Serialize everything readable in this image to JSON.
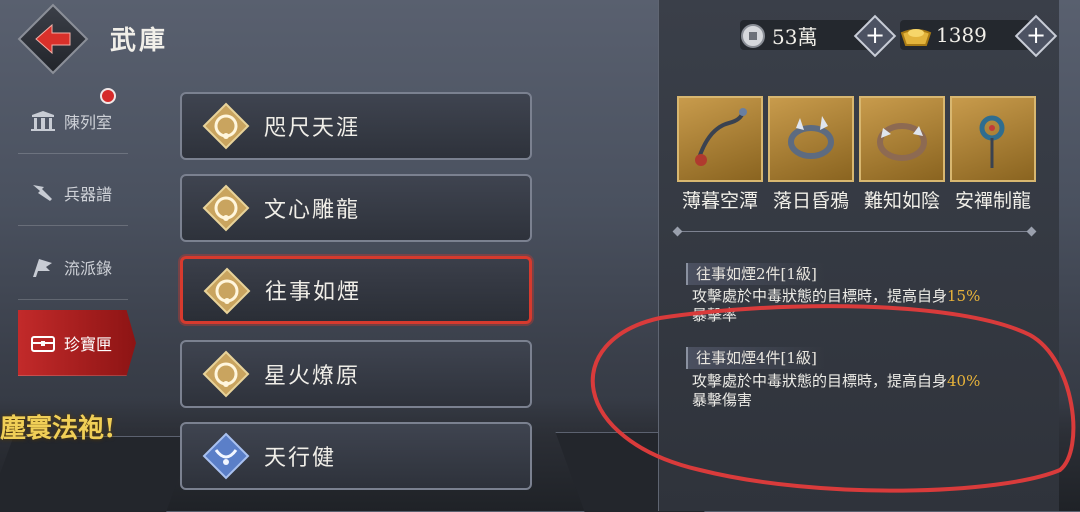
{
  "header": {
    "title": "武庫"
  },
  "currency": {
    "silver": {
      "icon": "silver-coin-icon",
      "value": "53萬"
    },
    "gold": {
      "icon": "gold-ingot-icon",
      "value": "1389"
    }
  },
  "nav": {
    "items": [
      {
        "label": "陳列室",
        "icon": "gate-icon"
      },
      {
        "label": "兵器譜",
        "icon": "weapon-scroll-icon"
      },
      {
        "label": "流派錄",
        "icon": "flag-icon"
      },
      {
        "label": "珍寶匣",
        "icon": "treasure-chest-icon"
      }
    ],
    "active_index": 3
  },
  "promo_text": "塵寰法袍!",
  "sets": [
    {
      "label": "咫尺天涯",
      "icon": "gold-necklace-icon"
    },
    {
      "label": "文心雕龍",
      "icon": "gold-necklace-icon"
    },
    {
      "label": "往事如煙",
      "icon": "gold-necklace-icon"
    },
    {
      "label": "星火燎原",
      "icon": "gold-necklace-icon"
    },
    {
      "label": "天行健",
      "icon": "blue-necklace-icon"
    }
  ],
  "active_set_index": 2,
  "pieces": [
    {
      "label": "薄暮空潭",
      "icon": "chain-icon"
    },
    {
      "label": "落日昏鴉",
      "icon": "spiked-ring-icon"
    },
    {
      "label": "難知如陰",
      "icon": "bracelet-icon"
    },
    {
      "label": "安禪制龍",
      "icon": "pendant-icon"
    }
  ],
  "bonuses": [
    {
      "title": "往事如煙2件[1級]",
      "desc_pre": "攻擊處於中毒狀態的目標時，提高自身",
      "highlight": "15%",
      "desc_post": "暴擊率"
    },
    {
      "title": "往事如煙4件[1級]",
      "desc_pre": "攻擊處於中毒狀態的目標時，提高自身",
      "highlight": "40%",
      "desc_post": "暴擊傷害"
    }
  ],
  "colors": {
    "accent_red": "#d63a2e",
    "highlight_gold": "#e8b33a",
    "annotation_red": "#d93b3b"
  }
}
